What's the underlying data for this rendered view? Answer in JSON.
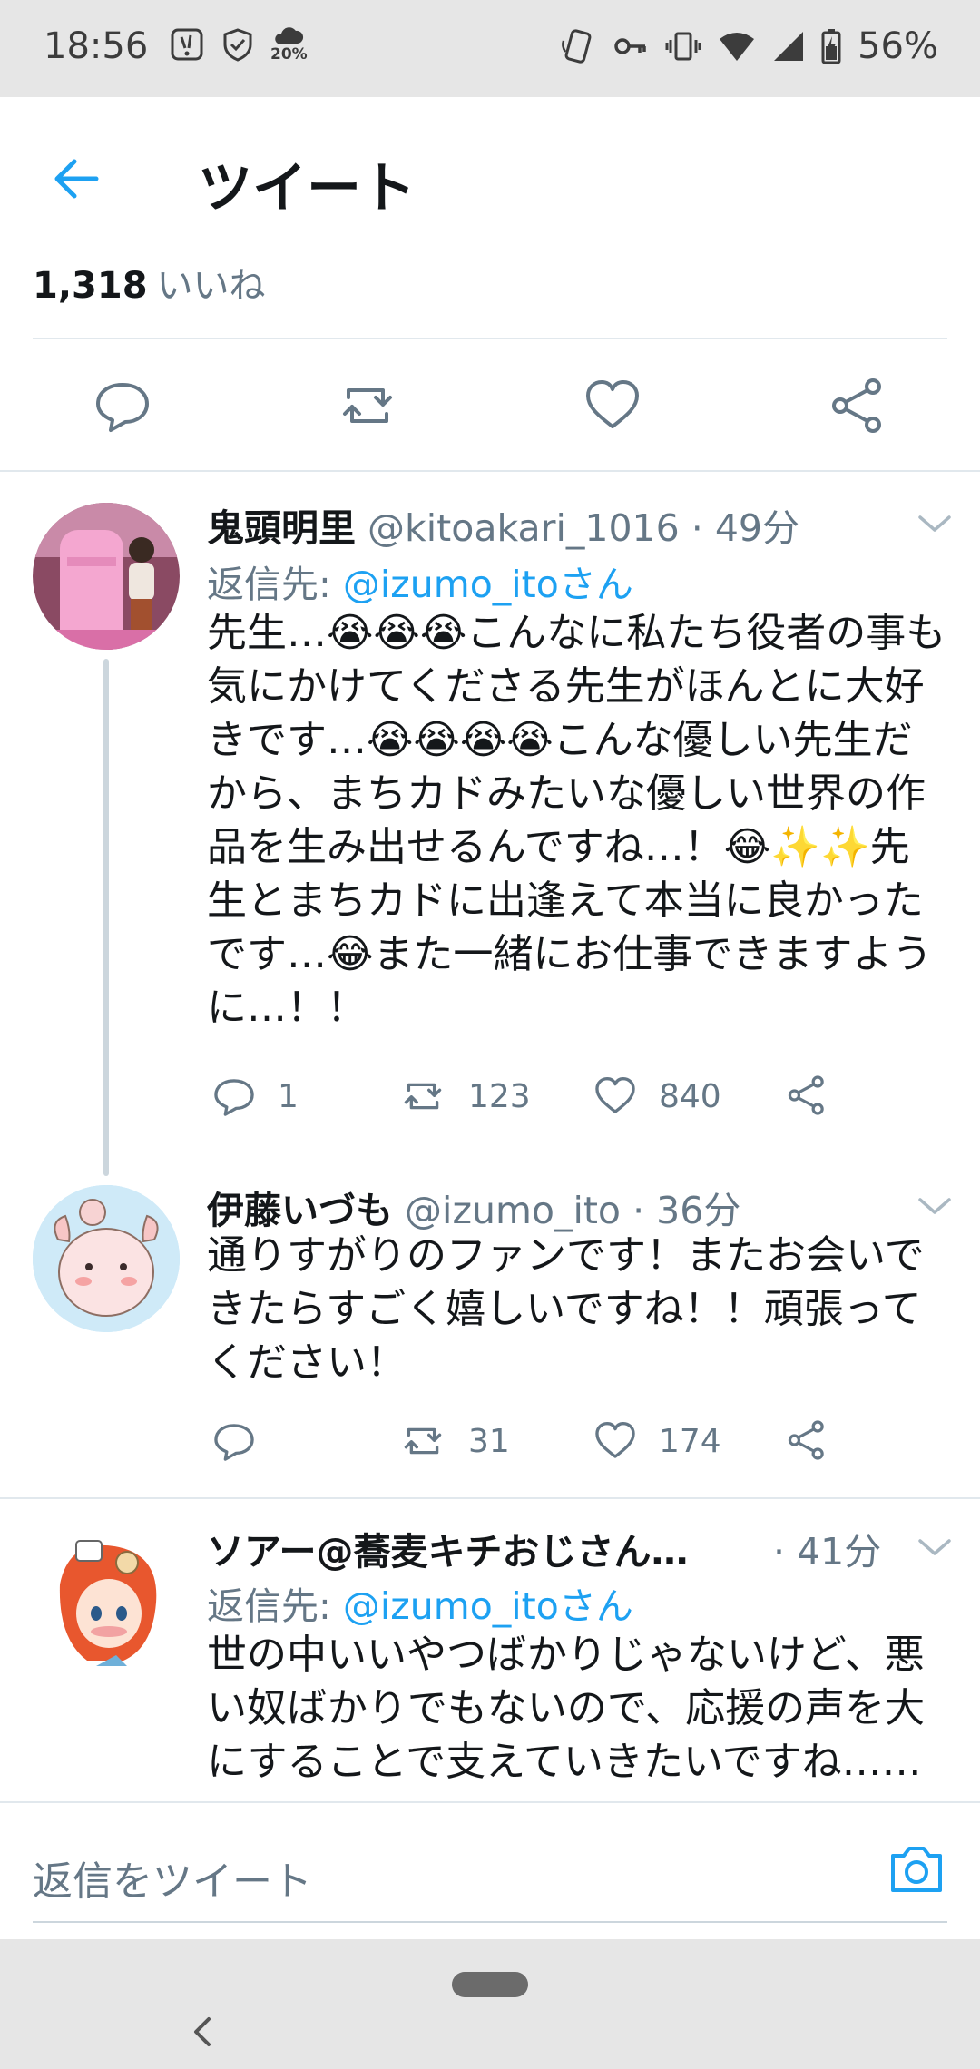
{
  "status_bar": {
    "time": "18:56",
    "battery": "56%",
    "left_icons": [
      "notification-icon",
      "shield-check-icon",
      "weather-icon"
    ],
    "weather_badge": "20%",
    "right_icons": [
      "nfc-icon",
      "key-icon",
      "vibrate-icon",
      "wifi-icon",
      "signal-icon",
      "battery-icon"
    ]
  },
  "header": {
    "title": "ツイート"
  },
  "likes": {
    "count": "1,318",
    "label": "いいね"
  },
  "tweets": [
    {
      "name": "鬼頭明里",
      "handle": "@kitoakari_1016",
      "time": "· 49分",
      "reply_prefix": "返信先: ",
      "reply_to": "@izumo_itoさん",
      "body": "先生…😭😭😭こんなに私たち役者の事も気にかけてくださる先生がほんとに大好きです…😭😭😭😭こんな優しい先生だから、まちカドみたいな優しい世界の作品を生み出せるんですね…！😂✨✨先生とまちカドに出逢えて本当に良かったです…😂また一緒にお仕事できますように…！！",
      "replies": "1",
      "retweets": "123",
      "likes": "840"
    },
    {
      "name": "伊藤いづも",
      "handle": "@izumo_ito",
      "time": "· 36分",
      "body": "通りすがりのファンです！またお会いできたらすごく嬉しいですね！！頑張ってください！",
      "replies": "",
      "retweets": "31",
      "likes": "174"
    },
    {
      "name": "ソアー@蕎麦キチおじさん…",
      "time": "· 41分",
      "reply_prefix": "返信先: ",
      "reply_to": "@izumo_itoさん",
      "body": "世の中いいやつばかりじゃないけど、悪い奴ばかりでもないので、応援の声を大にすることで支えていきたいですね……"
    }
  ],
  "compose": {
    "placeholder": "返信をツイート"
  },
  "colors": {
    "accent": "#1da1f2",
    "secondary_text": "#657786",
    "divider": "#e1e8ed"
  }
}
